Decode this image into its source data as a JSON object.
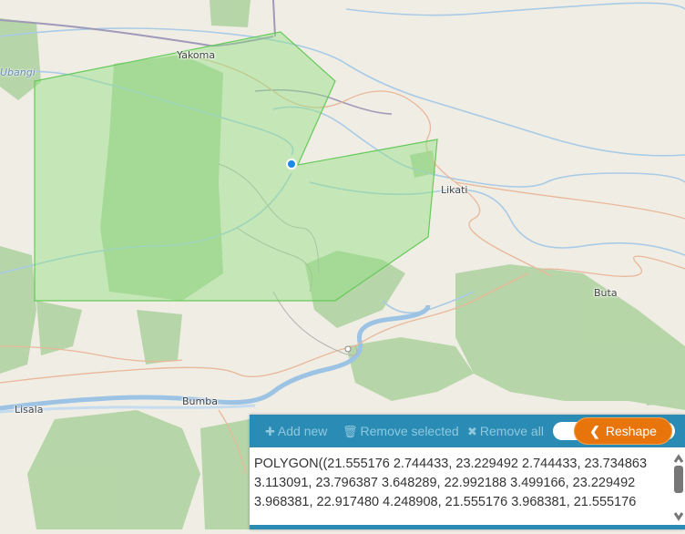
{
  "map": {
    "places": [
      "Yakoma",
      "Likati",
      "Buta",
      "Bumba",
      "Lisala"
    ],
    "water": [
      "Ubangi"
    ]
  },
  "toolbar": {
    "add_new": "Add new",
    "remove_selected": "Remove selected",
    "remove_all": "Remove all",
    "reshape": "Reshape"
  },
  "wkt": {
    "value": "POLYGON((21.555176 2.744433, 23.229492 2.744433, 23.734863 3.113091, 23.796387 3.648289, 22.992188 3.499166, 23.229492 3.968381, 22.917480 4.248908, 21.555176 3.968381, 21.555176"
  },
  "colors": {
    "toolbar": "#2a8cb4",
    "reshape": "#e8740c",
    "polygon_fill": "#90e080",
    "vertex": "#1e88e5"
  }
}
